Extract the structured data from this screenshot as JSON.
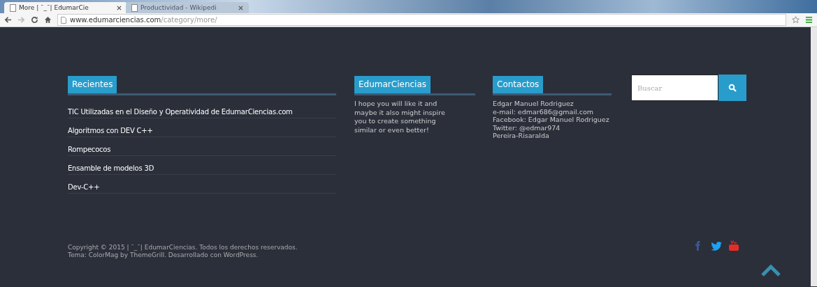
{
  "browser": {
    "tabs": [
      {
        "title": "More | ¯_¯| EdumarCie",
        "selected": true
      },
      {
        "title": "Productividad - Wikipedi",
        "selected": false
      }
    ],
    "address": {
      "host": "www.edumarciencias.com",
      "path": "/category/more/"
    }
  },
  "recientes": {
    "title": "Recientes",
    "items": [
      "TIC Utilizadas en el Diseño y Operatividad de EdumarCiencias.com",
      "Algoritmos con DEV C++",
      "Rompecocos",
      "Ensamble de modelos 3D",
      "Dev-C++"
    ]
  },
  "about": {
    "title": "EdumarCiencias",
    "text": "I hope you will like it and maybe it also might inspire you to create something similar or even better!"
  },
  "contacts": {
    "title": "Contactos",
    "lines": [
      "Edgar Manuel Rodriguez",
      "e-mail: edmar686@gmail.com",
      "Facebook: Edgar Manuel Rodriguez",
      "Twitter: @edmar974",
      "Pereira-Risaralda"
    ]
  },
  "search": {
    "placeholder": "Buscar"
  },
  "footer": {
    "lines": [
      "Copyright © 2015 | ¯_¯| EdumarCiencias. Todos los derechos reservados.",
      "Tema: ColorMag by ThemeGrill. Desarrollado con WordPress."
    ],
    "social": [
      {
        "kind": "facebook"
      },
      {
        "kind": "twitter"
      },
      {
        "kind": "youtube"
      }
    ]
  }
}
